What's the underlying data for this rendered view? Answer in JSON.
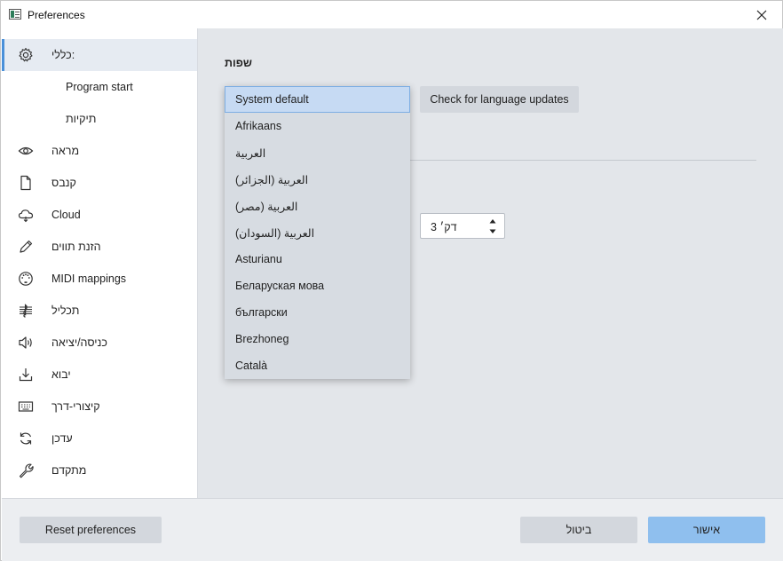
{
  "window": {
    "title": "Preferences"
  },
  "sidebar": {
    "items": [
      {
        "label": "כללי:",
        "icon": "gear-icon",
        "selected": true
      },
      {
        "label": "Program start",
        "sub": true
      },
      {
        "label": "תיקיות",
        "sub": true
      },
      {
        "label": "מראה",
        "icon": "eye-icon"
      },
      {
        "label": "קנבס",
        "icon": "document-icon"
      },
      {
        "label": "Cloud",
        "icon": "cloud-icon"
      },
      {
        "label": "הזנת תווים",
        "icon": "pencil-icon"
      },
      {
        "label": "MIDI mappings",
        "icon": "midi-icon"
      },
      {
        "label": "תכליל",
        "icon": "score-icon"
      },
      {
        "label": "כניסה/יציאה",
        "icon": "speaker-icon"
      },
      {
        "label": "יבוא",
        "icon": "import-icon"
      },
      {
        "label": "קיצורי-דרך",
        "icon": "keyboard-icon"
      },
      {
        "label": "עדכן",
        "icon": "refresh-icon"
      },
      {
        "label": "מתקדם",
        "icon": "wrench-icon"
      }
    ]
  },
  "general": {
    "languages_title": "שפות",
    "check_updates_label": "Check for language updates",
    "autosave_value": "3 דק׳"
  },
  "language_dropdown": {
    "selected": "System default",
    "options": [
      "System default",
      "Afrikaans",
      "العربية",
      "العربية (الجزائر)",
      "العربية (مصر)",
      "العربية (السودان)",
      "Asturianu",
      "Беларуская мова",
      "български",
      "Brezhoneg",
      "Català"
    ]
  },
  "footer": {
    "reset_label": "Reset preferences",
    "cancel_label": "ביטול",
    "ok_label": "אישור"
  },
  "colors": {
    "accent": "#4a90d9",
    "primary_button": "#8fbfee",
    "selected_option": "#c6daf3",
    "content_bg": "#e3e6ea"
  }
}
